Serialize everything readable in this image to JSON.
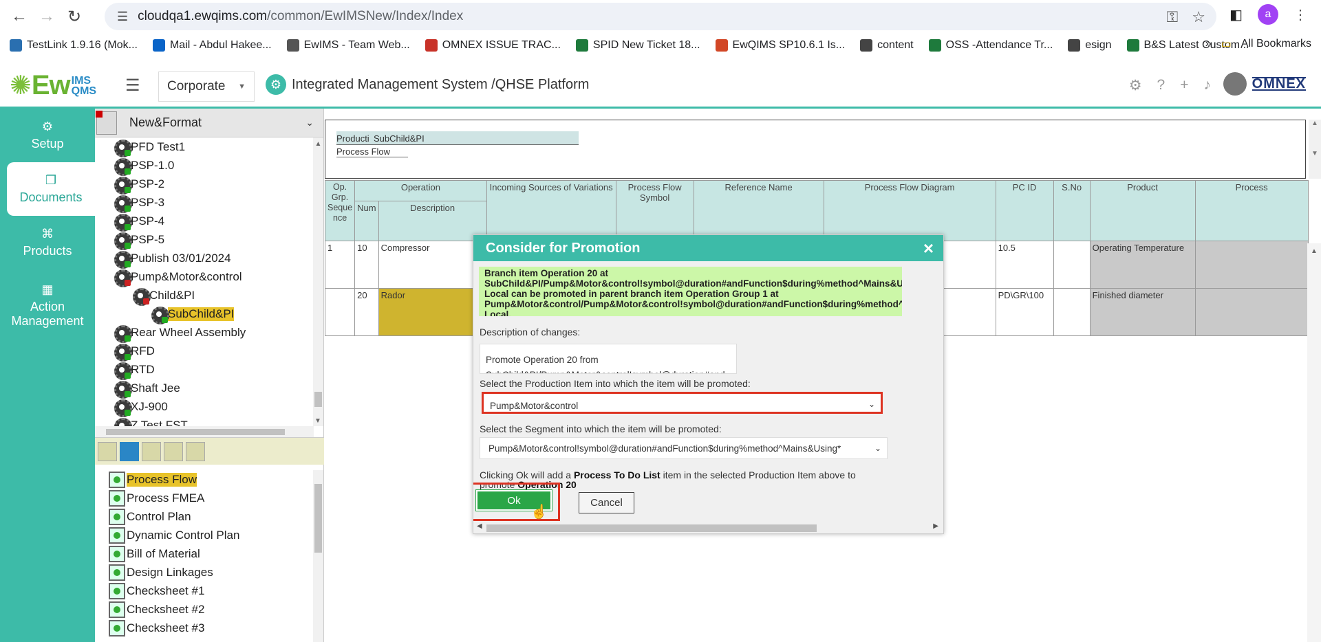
{
  "browser": {
    "url_host": "cloudqa1.ewqims.com",
    "url_path": "/common/EwIMSNew/Index/Index",
    "profile_initial": "a"
  },
  "bookmarks": [
    {
      "label": "TestLink 1.9.16 (Mok...",
      "color": "#2a6fb0"
    },
    {
      "label": "Mail - Abdul Hakee...",
      "color": "#0a64c8"
    },
    {
      "label": "EwIMS - Team Web...",
      "color": "#555555"
    },
    {
      "label": "OMNEX ISSUE TRAC...",
      "color": "#c83228"
    },
    {
      "label": "SPID New Ticket 18...",
      "color": "#1e7a3c"
    },
    {
      "label": "EwQIMS SP10.6.1 Is...",
      "color": "#d24726"
    },
    {
      "label": "content",
      "color": "#444444"
    },
    {
      "label": "OSS -Attendance Tr...",
      "color": "#1e7a3c"
    },
    {
      "label": "esign",
      "color": "#444444"
    },
    {
      "label": "B&S Latest Custom...",
      "color": "#1e7a3c"
    }
  ],
  "bookmarks_more": "»",
  "all_bookmarks": "All Bookmarks",
  "app": {
    "logo_main": "Ew",
    "logo_ims": "IMS",
    "logo_qms": "QMS",
    "site": "Corporate",
    "title": "Integrated Management System /QHSE Platform",
    "brand": "OMNEX"
  },
  "leftnav": [
    {
      "label": "Setup",
      "icon": "gears-icon"
    },
    {
      "label": "Documents",
      "icon": "documents-icon"
    },
    {
      "label": "Products",
      "icon": "products-icon"
    },
    {
      "label": "Action Management",
      "icon": "action-icon"
    }
  ],
  "tree": {
    "header": "New&Format",
    "nodes": [
      {
        "label": "PFD Test1",
        "indent": 0,
        "mark": "green"
      },
      {
        "label": "PSP-1.0",
        "indent": 0,
        "mark": "green"
      },
      {
        "label": "PSP-2",
        "indent": 0,
        "mark": "green"
      },
      {
        "label": "PSP-3",
        "indent": 0,
        "mark": "green"
      },
      {
        "label": "PSP-4",
        "indent": 0,
        "mark": "green"
      },
      {
        "label": "PSP-5",
        "indent": 0,
        "mark": "green"
      },
      {
        "label": "Publish 03/01/2024",
        "indent": 0,
        "mark": "green"
      },
      {
        "label": "Pump&Motor&control",
        "indent": 0,
        "mark": "red"
      },
      {
        "label": "Child&PI",
        "indent": 1,
        "mark": "red"
      },
      {
        "label": "SubChild&PI",
        "indent": 2,
        "mark": "green",
        "selected": true
      },
      {
        "label": "Rear Wheel Assembly",
        "indent": 0,
        "mark": "green"
      },
      {
        "label": "RFD",
        "indent": 0,
        "mark": "green"
      },
      {
        "label": "RTD",
        "indent": 0,
        "mark": "green"
      },
      {
        "label": "Shaft Jee",
        "indent": 0,
        "mark": "green"
      },
      {
        "label": "XJ-900",
        "indent": 0,
        "mark": "green"
      },
      {
        "label": "Z Test FST",
        "indent": 0,
        "mark": "green"
      }
    ]
  },
  "docs": [
    {
      "label": "Process Flow",
      "selected": true
    },
    {
      "label": "Process FMEA"
    },
    {
      "label": "Control Plan"
    },
    {
      "label": "Dynamic Control Plan"
    },
    {
      "label": "Bill of Material"
    },
    {
      "label": "Design Linkages"
    },
    {
      "label": "Checksheet #1"
    },
    {
      "label": "Checksheet #2"
    },
    {
      "label": "Checksheet #3"
    }
  ],
  "breadcrumb": {
    "part1": "Producti",
    "part2": "SubChild&PI",
    "line2": "Process Flow"
  },
  "grid": {
    "h_op_grp": "Op. Grp. Seque nce",
    "h_operation": "Operation",
    "h_num": "Num",
    "h_description": "Description",
    "h_incoming": "Incoming Sources of Variations",
    "h_symbol": "Process Flow Symbol",
    "h_reference": "Reference Name",
    "h_diagram": "Process Flow Diagram",
    "h_pcid": "PC ID",
    "h_sno": "S.No",
    "h_product": "Product",
    "h_process": "Process",
    "rows": [
      {
        "grp": "1",
        "num": "10",
        "desc": "Compressor",
        "pcid": "10.5",
        "product": "Operating Temperature"
      },
      {
        "grp": "",
        "num": "20",
        "desc": "Rador",
        "pcid": "PD\\GR\\100",
        "product": "Finished diameter"
      }
    ]
  },
  "modal": {
    "title": "Consider for Promotion",
    "close": "×",
    "note_lines": [
      "Branch item Operation 20 at",
      "SubChild&PI/Pump&Motor&control!symbol@duration#andFunction$during%method^Mains&Using*",
      "Local can be promoted in parent branch item Operation Group 1 at",
      "Pump&Motor&control/Pump&Motor&control!symbol@duration#andFunction$during%method^Mains&Using*",
      "Local."
    ],
    "desc_label": "Description of changes:",
    "desc_value_1": "Promote Operation 20 from",
    "desc_value_2": "SubChild&PI/Pump&Motor&control!symbol@duration#and",
    "prod_label": "Select the Production Item into which the item will be promoted:",
    "prod_value": "Pump&Motor&control",
    "seg_label": "Select the Segment into which the item will be promoted:",
    "seg_value": "Pump&Motor&control!symbol@duration#andFunction$during%method^Mains&Using*",
    "info_pre": "Clicking Ok will add a ",
    "info_bold": "Process To Do List",
    "info_mid": " item in the selected Production Item above to",
    "info_pre2": "promote ",
    "info_bold2": "Operation 20",
    "ok": "Ok",
    "cancel": "Cancel"
  }
}
